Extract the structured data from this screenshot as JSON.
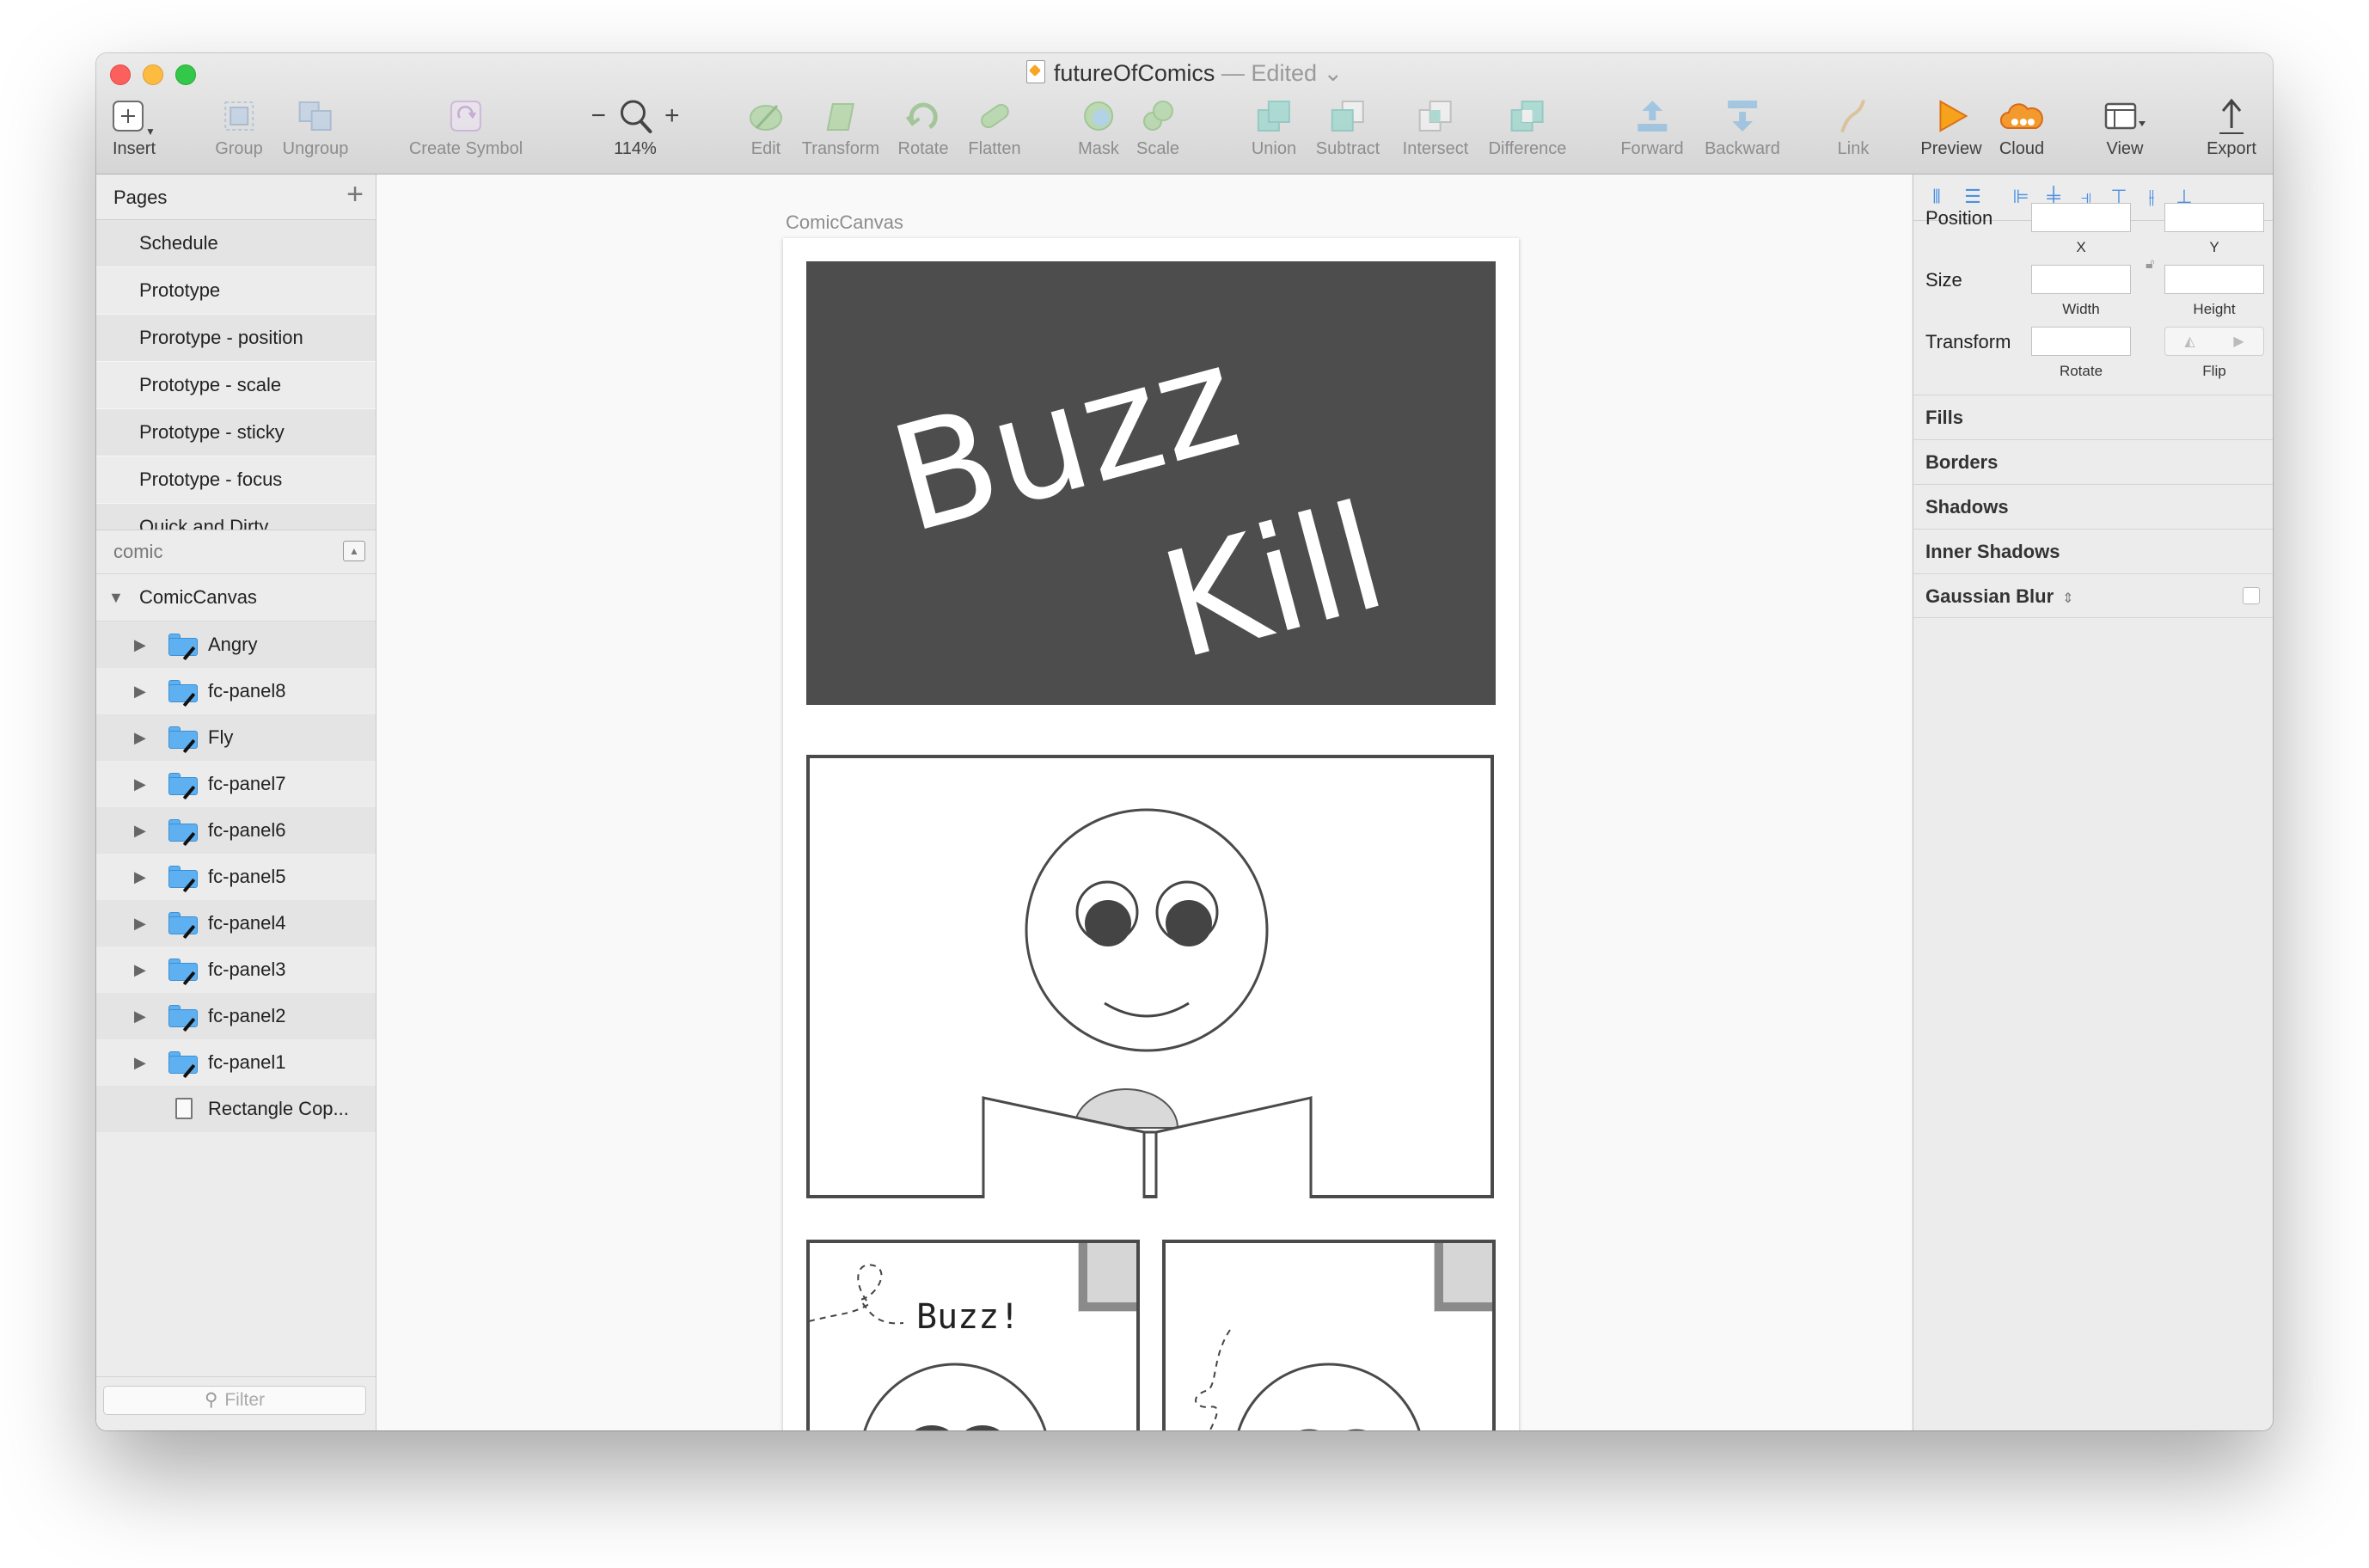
{
  "window": {
    "title": "futureOfComics",
    "edited": " — Edited",
    "title_caret": "⌄"
  },
  "toolbar": {
    "insert": "Insert",
    "group": "Group",
    "ungroup": "Ungroup",
    "create_symbol": "Create Symbol",
    "zoom_minus": "−",
    "zoom_plus": "+",
    "zoom_level": "114%",
    "edit": "Edit",
    "transform": "Transform",
    "rotate": "Rotate",
    "flatten": "Flatten",
    "mask": "Mask",
    "scale": "Scale",
    "union": "Union",
    "subtract": "Subtract",
    "intersect": "Intersect",
    "difference": "Difference",
    "forward": "Forward",
    "backward": "Backward",
    "link": "Link",
    "preview": "Preview",
    "cloud": "Cloud",
    "view": "View",
    "export": "Export"
  },
  "pages": {
    "header": "Pages",
    "add": "+",
    "items": [
      "Schedule",
      "Prototype",
      "Prorotype - position",
      "Prototype - scale",
      "Prototype - sticky",
      "Prototype - focus",
      "Quick and Dirty"
    ]
  },
  "layers": {
    "page_name": "comic",
    "root": "ComicCanvas",
    "items": [
      "Angry",
      "fc-panel8",
      "Fly",
      "fc-panel7",
      "fc-panel6",
      "fc-panel5",
      "fc-panel4",
      "fc-panel3",
      "fc-panel2",
      "fc-panel1"
    ],
    "rectangle": "Rectangle Cop...",
    "filter_placeholder": "Filter"
  },
  "canvas": {
    "artboard_name": "ComicCanvas",
    "panel1_text_line1": "Buzz",
    "panel1_text_line2": "Kill",
    "buzz_caption": "Buzz!"
  },
  "inspector": {
    "position": "Position",
    "x": "X",
    "y": "Y",
    "size": "Size",
    "width": "Width",
    "height": "Height",
    "transform": "Transform",
    "rotate": "Rotate",
    "flip": "Flip",
    "sections": [
      "Fills",
      "Borders",
      "Shadows",
      "Inner Shadows",
      "Gaussian Blur"
    ]
  },
  "colors": {
    "accent": "#4a90e2",
    "folder": "#5fb0f0",
    "dark_panel": "#4d4d4d"
  }
}
